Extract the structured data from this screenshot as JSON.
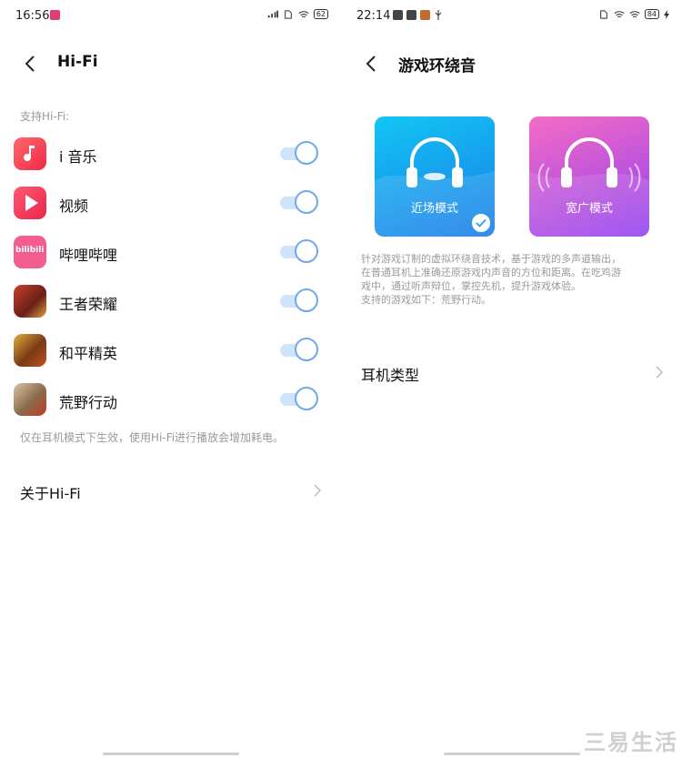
{
  "left": {
    "status": {
      "time": "16:56",
      "battery": "62"
    },
    "header": {
      "title": "Hi-Fi"
    },
    "section_label": "支持Hi-Fi:",
    "apps": [
      {
        "name": "i 音乐",
        "enabled": true
      },
      {
        "name": "视频",
        "enabled": true
      },
      {
        "name": "哔哩哔哩",
        "enabled": true,
        "icon_text": "bilibili"
      },
      {
        "name": "王者荣耀",
        "enabled": true
      },
      {
        "name": "和平精英",
        "enabled": true
      },
      {
        "name": "荒野行动",
        "enabled": true
      }
    ],
    "note": "仅在耳机模式下生效，使用Hi-Fi进行播放会增加耗电。",
    "about_label": "关于Hi-Fi"
  },
  "right": {
    "status": {
      "time": "22:14",
      "battery": "84"
    },
    "header": {
      "title": "游戏环绕音"
    },
    "modes": [
      {
        "label": "近场模式",
        "selected": true,
        "color_start": "#12c6f4",
        "color_end": "#1a6fe8"
      },
      {
        "label": "宽广模式",
        "selected": false,
        "color_start": "#f062c9",
        "color_end": "#8a3df0"
      }
    ],
    "description": [
      "针对游戏订制的虚拟环绕音技术，基于游戏的多声道输出，",
      "在普通耳机上准确还原游戏内声音的方位和距离。在吃鸡游",
      "戏中，通过听声辩位，掌控先机，提升游戏体验。",
      "支持的游戏如下：荒野行动。"
    ],
    "earphone_type_label": "耳机类型"
  },
  "watermark": "三易生活",
  "colors": {
    "toggle_track": "#cfe3fb",
    "toggle_knob_border": "#6fa8ef",
    "check_blue": "#2b9fe8"
  }
}
